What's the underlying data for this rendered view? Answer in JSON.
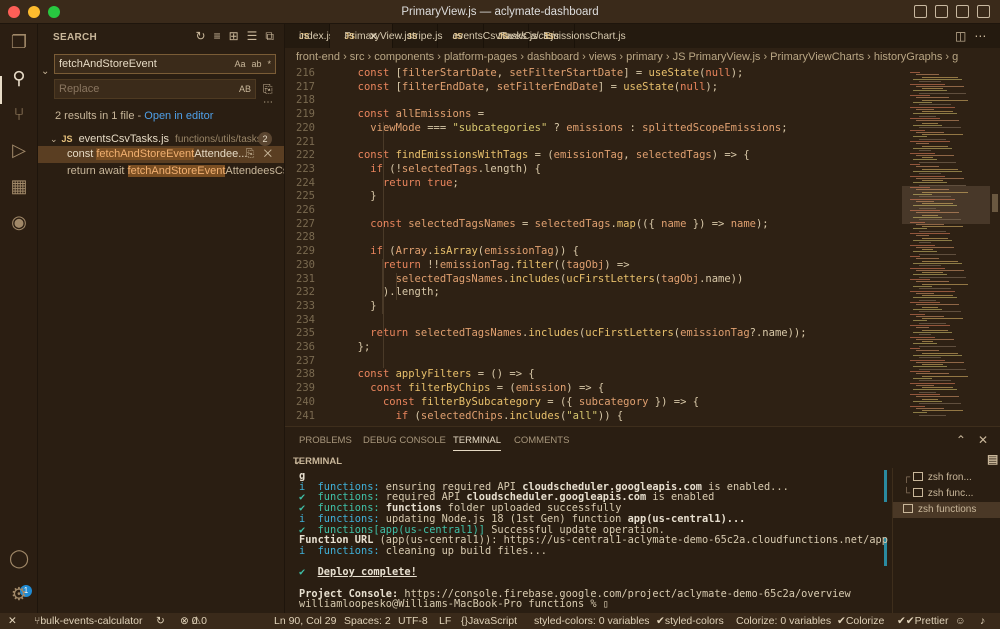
{
  "window": {
    "title": "PrimaryView.js — aclymate-dashboard",
    "traffic_colors": [
      "#fe5f57",
      "#febc2e",
      "#28c840"
    ]
  },
  "activity": {
    "icons": [
      "files-icon",
      "search-icon",
      "source-control-icon",
      "run-debug-icon",
      "extensions-icon",
      "github-icon",
      "account-icon",
      "settings-gear-icon"
    ],
    "badge": "1"
  },
  "search": {
    "header": "SEARCH",
    "query": "fetchAndStoreEvent",
    "replace_placeholder": "Replace",
    "query_opts": [
      "Aa",
      "ab",
      "*"
    ],
    "replace_opt": "AB",
    "results_text": "2 results in 1 file - ",
    "open_in_editor": "Open in editor",
    "file": {
      "name": "eventsCsvTasks.js",
      "path": "functions/utils/tasks",
      "count": "2"
    },
    "matches": [
      {
        "pre": "const ",
        "hit": "fetchAndStoreEvent",
        "post": "Attendee..."
      },
      {
        "pre": "return await ",
        "hit": "fetchAndStoreEvent",
        "post": "AttendeesCs..."
      }
    ]
  },
  "tabs": [
    {
      "label": "index.js",
      "active": false,
      "italic": false
    },
    {
      "label": "PrimaryView.js",
      "active": true,
      "italic": false
    },
    {
      "label": "stripe.js",
      "active": false,
      "italic": false
    },
    {
      "label": "eventsCsvTasks.js",
      "active": false,
      "italic": false
    },
    {
      "label": "travelCalcs.js",
      "active": false,
      "italic": true
    },
    {
      "label": "EmissionsChart.js",
      "active": false,
      "italic": false
    }
  ],
  "breadcrumb": "front-end  ›  src  ›  components  ›  platform-pages  ›  dashboard  ›  views  ›  primary  ›  JS PrimaryView.js  ›  PrimaryViewCharts  ›  historyGraphs  ›  g",
  "code": {
    "start": 216,
    "lines": [
      [
        [
          "  ",
          "pun"
        ],
        [
          "const ",
          "kw"
        ],
        [
          "[",
          "pun"
        ],
        [
          "filterStartDate",
          "id"
        ],
        [
          ", ",
          "pun"
        ],
        [
          "setFilterStartDate",
          "id"
        ],
        [
          "] = ",
          "pun"
        ],
        [
          "useState",
          "fnc"
        ],
        [
          "(",
          "pun"
        ],
        [
          "null",
          "kw"
        ],
        [
          ");",
          "pun"
        ]
      ],
      [
        [
          "  ",
          "pun"
        ],
        [
          "const ",
          "kw"
        ],
        [
          "[",
          "pun"
        ],
        [
          "filterEndDate",
          "id"
        ],
        [
          ", ",
          "pun"
        ],
        [
          "setFilterEndDate",
          "id"
        ],
        [
          "] = ",
          "pun"
        ],
        [
          "useState",
          "fnc"
        ],
        [
          "(",
          "pun"
        ],
        [
          "null",
          "kw"
        ],
        [
          ");",
          "pun"
        ]
      ],
      [],
      [
        [
          "  ",
          "pun"
        ],
        [
          "const ",
          "kw"
        ],
        [
          "allEmissions",
          "id"
        ],
        [
          " =",
          "pun"
        ]
      ],
      [
        [
          "    ",
          "pun"
        ],
        [
          "viewMode",
          "id"
        ],
        [
          " === ",
          "pun"
        ],
        [
          "\"subcategories\"",
          "str"
        ],
        [
          " ? ",
          "pun"
        ],
        [
          "emissions",
          "id"
        ],
        [
          " : ",
          "pun"
        ],
        [
          "splittedScopeEmissions",
          "id"
        ],
        [
          ";",
          "pun"
        ]
      ],
      [],
      [
        [
          "  ",
          "pun"
        ],
        [
          "const ",
          "kw"
        ],
        [
          "findEmissionsWithTags",
          "fnc"
        ],
        [
          " = (",
          "pun"
        ],
        [
          "emissionTag",
          "id"
        ],
        [
          ", ",
          "pun"
        ],
        [
          "selectedTags",
          "id"
        ],
        [
          ") => {",
          "pun"
        ]
      ],
      [
        [
          "    ",
          "pun"
        ],
        [
          "if ",
          "kw"
        ],
        [
          "(!",
          "pun"
        ],
        [
          "selectedTags",
          "id"
        ],
        [
          ".length) {",
          "pun"
        ]
      ],
      [
        [
          "      ",
          "pun"
        ],
        [
          "return ",
          "kw"
        ],
        [
          "true",
          "kw"
        ],
        [
          ";",
          "pun"
        ]
      ],
      [
        [
          "    }",
          "pun"
        ]
      ],
      [],
      [
        [
          "    ",
          "pun"
        ],
        [
          "const ",
          "kw"
        ],
        [
          "selectedTagsNames",
          "id"
        ],
        [
          " = ",
          "pun"
        ],
        [
          "selectedTags",
          "id"
        ],
        [
          ".",
          "pun"
        ],
        [
          "map",
          "fnc"
        ],
        [
          "(({ ",
          "pun"
        ],
        [
          "name",
          "id"
        ],
        [
          " }) => ",
          "pun"
        ],
        [
          "name",
          "id"
        ],
        [
          ");",
          "pun"
        ]
      ],
      [],
      [
        [
          "    ",
          "pun"
        ],
        [
          "if ",
          "kw"
        ],
        [
          "(",
          "pun"
        ],
        [
          "Array",
          "id"
        ],
        [
          ".",
          "pun"
        ],
        [
          "isArray",
          "fnc"
        ],
        [
          "(",
          "pun"
        ],
        [
          "emissionTag",
          "id"
        ],
        [
          ")) {",
          "pun"
        ]
      ],
      [
        [
          "      ",
          "pun"
        ],
        [
          "return ",
          "kw"
        ],
        [
          "!!",
          "pun"
        ],
        [
          "emissionTag",
          "id"
        ],
        [
          ".",
          "pun"
        ],
        [
          "filter",
          "fnc"
        ],
        [
          "((",
          "pun"
        ],
        [
          "tagObj",
          "id"
        ],
        [
          ") =>",
          "pun"
        ]
      ],
      [
        [
          "        ",
          "pun"
        ],
        [
          "selectedTagsNames",
          "id"
        ],
        [
          ".",
          "pun"
        ],
        [
          "includes",
          "fnc"
        ],
        [
          "(",
          "pun"
        ],
        [
          "ucFirstLetters",
          "fnc"
        ],
        [
          "(",
          "pun"
        ],
        [
          "tagObj",
          "id"
        ],
        [
          ".name))",
          "pun"
        ]
      ],
      [
        [
          "      ).length;",
          "pun"
        ]
      ],
      [
        [
          "    }",
          "pun"
        ]
      ],
      [],
      [
        [
          "    ",
          "pun"
        ],
        [
          "return ",
          "kw"
        ],
        [
          "selectedTagsNames",
          "id"
        ],
        [
          ".",
          "pun"
        ],
        [
          "includes",
          "fnc"
        ],
        [
          "(",
          "pun"
        ],
        [
          "ucFirstLetters",
          "fnc"
        ],
        [
          "(",
          "pun"
        ],
        [
          "emissionTag",
          "id"
        ],
        [
          "?.name));",
          "pun"
        ]
      ],
      [
        [
          "  };",
          "pun"
        ]
      ],
      [],
      [
        [
          "  ",
          "pun"
        ],
        [
          "const ",
          "kw"
        ],
        [
          "applyFilters",
          "fnc"
        ],
        [
          " = () => {",
          "pun"
        ]
      ],
      [
        [
          "    ",
          "pun"
        ],
        [
          "const ",
          "kw"
        ],
        [
          "filterByChips",
          "fnc"
        ],
        [
          " = (",
          "pun"
        ],
        [
          "emission",
          "id"
        ],
        [
          ") => {",
          "pun"
        ]
      ],
      [
        [
          "      ",
          "pun"
        ],
        [
          "const ",
          "kw"
        ],
        [
          "filterBySubcategory",
          "fnc"
        ],
        [
          " = ({ ",
          "pun"
        ],
        [
          "subcategory",
          "id"
        ],
        [
          " }) => {",
          "pun"
        ]
      ],
      [
        [
          "        ",
          "pun"
        ],
        [
          "if ",
          "kw"
        ],
        [
          "(",
          "pun"
        ],
        [
          "selectedChips",
          "id"
        ],
        [
          ".",
          "pun"
        ],
        [
          "includes",
          "fnc"
        ],
        [
          "(",
          "pun"
        ],
        [
          "\"all\"",
          "str"
        ],
        [
          ")) {",
          "pun"
        ]
      ]
    ]
  },
  "panel": {
    "tabs": [
      "PROBLEMS",
      "DEBUG CONSOLE",
      "TERMINAL",
      "COMMENTS"
    ],
    "active": "TERMINAL",
    "terminal_header": "TERMINAL"
  },
  "terminal": {
    "lines": [
      [
        [
          "g",
          "tw"
        ]
      ],
      [
        [
          "i  ",
          "tc"
        ],
        [
          "functions:",
          "tc"
        ],
        [
          " ensuring required API ",
          ""
        ],
        [
          "cloudscheduler.googleapis.com",
          "tw"
        ],
        [
          " is enabled...",
          ""
        ]
      ],
      [
        [
          "✔  ",
          "tg"
        ],
        [
          "functions:",
          "tg"
        ],
        [
          " required API ",
          ""
        ],
        [
          "cloudscheduler.googleapis.com",
          "tw"
        ],
        [
          " is enabled",
          ""
        ]
      ],
      [
        [
          "✔  ",
          "tg"
        ],
        [
          "functions:",
          "tg"
        ],
        [
          " ",
          ""
        ],
        [
          "functions",
          "tw"
        ],
        [
          " folder uploaded successfully",
          ""
        ]
      ],
      [
        [
          "i  ",
          "tc"
        ],
        [
          "functions:",
          "tc"
        ],
        [
          " updating Node.js 18 (1st Gen) function ",
          ""
        ],
        [
          "app(us-central1)...",
          "tw"
        ]
      ],
      [
        [
          "✔  ",
          "tg"
        ],
        [
          "functions[app(us-central1)]",
          "tg"
        ],
        [
          " Successful update operation.",
          ""
        ]
      ],
      [
        [
          "Function URL",
          "tw"
        ],
        [
          " (app(us-central1)): https://us-central1-aclymate-demo-65c2a.cloudfunctions.net/app",
          ""
        ]
      ],
      [
        [
          "i  ",
          "tc"
        ],
        [
          "functions:",
          "tc"
        ],
        [
          " cleaning up build files...",
          ""
        ]
      ],
      [],
      [
        [
          "✔  ",
          "tg"
        ],
        [
          "Deploy complete!",
          "tw"
        ]
      ],
      [],
      [
        [
          "Project Console:",
          "tw"
        ],
        [
          " https://console.firebase.google.com/project/aclymate-demo-65c2a/overview",
          ""
        ]
      ],
      [
        [
          "williamloopesko@Williams-MacBook-Pro functions % ▯",
          ""
        ]
      ]
    ],
    "sessions": [
      "zsh fron...",
      "zsh func...",
      "zsh functions"
    ]
  },
  "status": {
    "branch": "bulk-events-calculator",
    "errors": "0",
    "warnings": "0",
    "position": "Ln 90, Col 29",
    "spaces": "Spaces: 2",
    "encoding": "UTF-8",
    "eol": "LF",
    "language": "JavaScript",
    "styled1": "styled-colors: 0 variables",
    "styled2": "styled-colors",
    "colorize": "Colorize: 0 variables",
    "colorize2": "Colorize",
    "prettier": "Prettier"
  }
}
